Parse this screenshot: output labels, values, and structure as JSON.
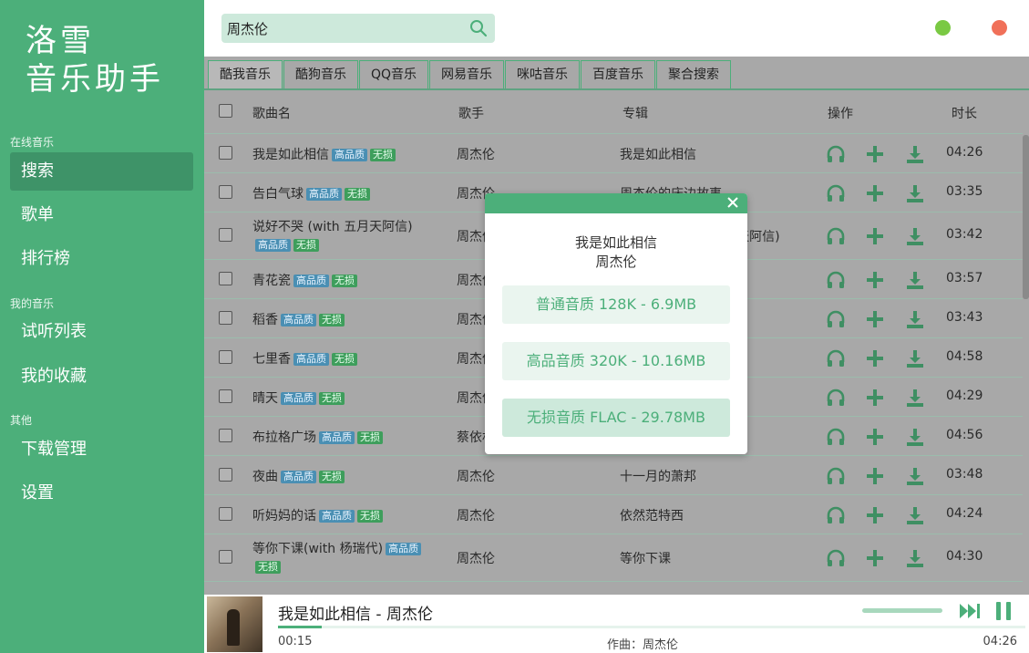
{
  "app": {
    "logo_line1": "洛雪",
    "logo_line2": "音乐助手"
  },
  "sidebar": {
    "section_online": "在线音乐",
    "search": "搜索",
    "playlist": "歌单",
    "charts": "排行榜",
    "section_mine": "我的音乐",
    "trial_list": "试听列表",
    "favorites": "我的收藏",
    "section_other": "其他",
    "downloads": "下载管理",
    "settings": "设置"
  },
  "search": {
    "value": "周杰伦",
    "placeholder": ""
  },
  "tabs": [
    "酷我音乐",
    "酷狗音乐",
    "QQ音乐",
    "网易音乐",
    "咪咕音乐",
    "百度音乐",
    "聚合搜索"
  ],
  "table": {
    "headers": {
      "name": "歌曲名",
      "artist": "歌手",
      "album": "专辑",
      "actions": "操作",
      "duration": "时长"
    },
    "badge_hq": "高品质",
    "badge_lossless": "无损",
    "rows": [
      {
        "name": "我是如此相信",
        "artist": "周杰伦",
        "album": "我是如此相信",
        "duration": "04:26",
        "hq": true,
        "ll": true,
        "wrap": false
      },
      {
        "name": "告白气球",
        "artist": "周杰伦",
        "album": "周杰伦的床边故事",
        "duration": "03:35",
        "hq": true,
        "ll": true,
        "wrap": false
      },
      {
        "name": "说好不哭 (with 五月天阿信)",
        "artist": "周杰伦",
        "album": "说好不哭 (with 五月天阿信)",
        "duration": "03:42",
        "hq": true,
        "ll": true,
        "wrap": true
      },
      {
        "name": "青花瓷",
        "artist": "周杰伦",
        "album": "",
        "duration": "03:57",
        "hq": true,
        "ll": true,
        "wrap": false
      },
      {
        "name": "稻香",
        "artist": "周杰伦",
        "album": "",
        "duration": "03:43",
        "hq": true,
        "ll": true,
        "wrap": false
      },
      {
        "name": "七里香",
        "artist": "周杰伦",
        "album": "",
        "duration": "04:58",
        "hq": true,
        "ll": true,
        "wrap": false
      },
      {
        "name": "晴天",
        "artist": "周杰伦",
        "album": "",
        "duration": "04:29",
        "hq": true,
        "ll": true,
        "wrap": false
      },
      {
        "name": "布拉格广场",
        "artist": "蔡依林",
        "album": "",
        "duration": "04:56",
        "hq": true,
        "ll": true,
        "wrap": false
      },
      {
        "name": "夜曲",
        "artist": "周杰伦",
        "album": "十一月的萧邦",
        "duration": "03:48",
        "hq": true,
        "ll": true,
        "wrap": false
      },
      {
        "name": "听妈妈的话",
        "artist": "周杰伦",
        "album": "依然范特西",
        "duration": "04:24",
        "hq": true,
        "ll": true,
        "wrap": false
      },
      {
        "name": "等你下课(with 杨瑞代)",
        "artist": "周杰伦",
        "album": "等你下课",
        "duration": "04:30",
        "hq": true,
        "ll": true,
        "wrap": true
      }
    ]
  },
  "dialog": {
    "song": "我是如此相信",
    "artist": "周杰伦",
    "options": [
      "普通音质 128K - 6.9MB",
      "高品音质 320K - 10.16MB",
      "无损音质 FLAC - 29.78MB"
    ]
  },
  "player": {
    "title": "我是如此相信 - 周杰伦",
    "current": "00:15",
    "composer": "作曲：周杰伦",
    "duration": "04:26",
    "progress": 0.059
  },
  "colors": {
    "accent": "#4caf7a",
    "hq_badge": "#4a8fb3",
    "lossless_badge": "#3e9e5c",
    "close_dot": "#f07059",
    "min_dot": "#7ac943"
  }
}
